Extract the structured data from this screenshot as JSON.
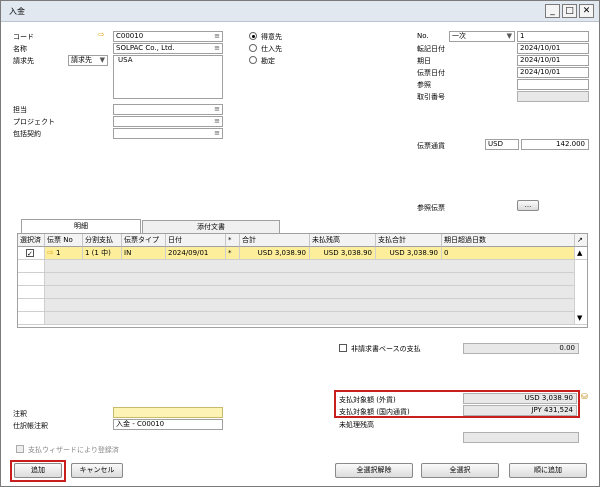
{
  "window": {
    "title": "入金"
  },
  "left": {
    "code_label": "コード",
    "code_value": "C00010",
    "name_label": "名称",
    "name_value": "SOLPAC Co., Ltd.",
    "bill_label": "請求先",
    "bill_select": "請求先",
    "bill_value": "USA",
    "contact_label": "担当",
    "project_label": "プロジェクト",
    "contract_label": "包括契約"
  },
  "radio": {
    "customer": "得意先",
    "vendor": "仕入先",
    "account": "勘定"
  },
  "right": {
    "no_label": "No.",
    "series": "一次",
    "no_value": "1",
    "posting_label": "転記日付",
    "posting_value": "2024/10/01",
    "due_label": "期日",
    "due_value": "2024/10/01",
    "doc_label": "伝票日付",
    "doc_value": "2024/10/01",
    "ref_label": "参照",
    "trans_label": "取引番号",
    "currency_label": "伝票通貨",
    "currency_code": "USD",
    "rate_value": "142.000",
    "refdoc_label": "参照伝票",
    "refdoc_btn": "..."
  },
  "tabs": {
    "detail": "明細",
    "attach": "添付文書"
  },
  "grid": {
    "headers": [
      "選択済",
      "伝票 No",
      "分割支払",
      "伝票タイプ",
      "日付",
      "*",
      "合計",
      "未払残高",
      "支払合計",
      "期日超過日数"
    ],
    "row": {
      "docno": "1",
      "split": "1 (1 中)",
      "type": "IN",
      "date": "2024/09/01",
      "star": "*",
      "total": "USD 3,038.90",
      "open": "USD 3,038.90",
      "paid": "USD 3,038.90",
      "overdue": "0"
    }
  },
  "noninvoice": {
    "label": "非請求書ベースの支払",
    "value": "0.00"
  },
  "amounts": {
    "fc_label": "支払対象額 (外貨)",
    "fc_value": "USD 3,038.90",
    "lc_label": "支払対象額 (国内通貨)",
    "lc_value": "JPY 431,524",
    "open_label": "未処理残高"
  },
  "bottom": {
    "remarks_label": "注釈",
    "journal_label": "仕訳帳注釈",
    "journal_value": "入金 - C00010",
    "wizard_label": "支払ウィザードにより登録済",
    "add_btn": "追加",
    "cancel_btn": "キャンセル",
    "deselect_btn": "全選択解除",
    "selectall_btn": "全選択",
    "addtoo_btn": "順に追加"
  }
}
